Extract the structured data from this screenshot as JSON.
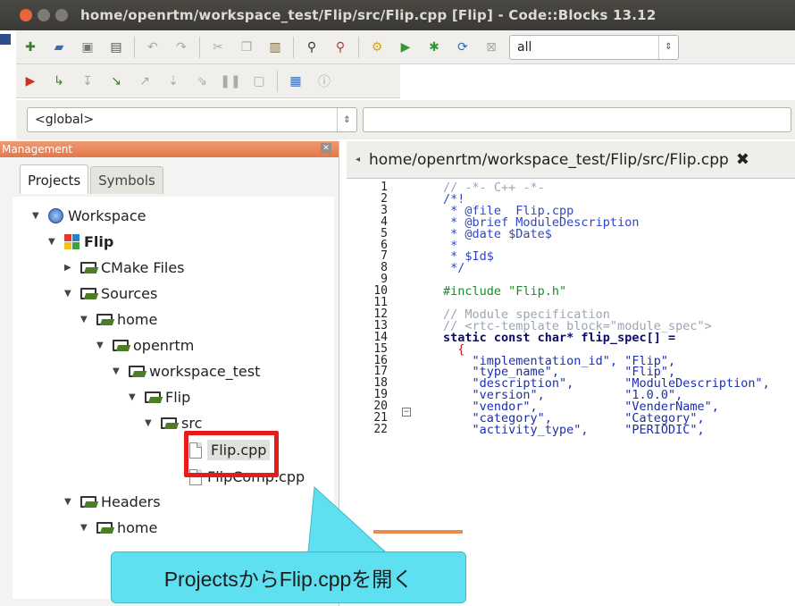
{
  "window": {
    "title": "home/openrtm/workspace_test/Flip/src/Flip.cpp [Flip] - Code::Blocks 13.12"
  },
  "toolbar": {
    "build_target": "all"
  },
  "scope": {
    "selected": "<global>"
  },
  "management": {
    "title": "Management",
    "tabs": [
      {
        "label": "Projects",
        "active": true
      },
      {
        "label": "Symbols",
        "active": false
      }
    ],
    "tree": {
      "workspace": "Workspace",
      "project": "Flip",
      "cmake_files": "CMake Files",
      "sources": "Sources",
      "home": "home",
      "openrtm": "openrtm",
      "workspace_test": "workspace_test",
      "flip_dir": "Flip",
      "src": "src",
      "flip_cpp": "Flip.cpp",
      "flipcomp_cpp": "FlipComp.cpp",
      "headers": "Headers",
      "headers_home": "home"
    }
  },
  "editor": {
    "tab_label": "home/openrtm/workspace_test/Flip/src/Flip.cpp",
    "line_numbers": [
      "1",
      "2",
      "3",
      "4",
      "5",
      "6",
      "7",
      "8",
      "9",
      "10",
      "11",
      "12",
      "13",
      "14",
      "15",
      "16",
      "17",
      "18",
      "19",
      "20",
      "21",
      "22"
    ],
    "lines": [
      "// -*- C++ -*-",
      "/*!",
      " * @file  Flip.cpp",
      " * @brief ModuleDescription",
      " * @date $Date$",
      " *",
      " * $Id$",
      " */",
      "",
      "#include \"Flip.h\"",
      "",
      "// Module specification",
      "// <rtc-template block=\"module_spec\">",
      "static const char* flip_spec[] =",
      "  {",
      "    \"implementation_id\", \"Flip\",",
      "    \"type_name\",         \"Flip\",",
      "    \"description\",       \"ModuleDescription\",",
      "    \"version\",           \"1.0.0\",",
      "    \"vendor\",            \"VenderName\",",
      "    \"category\",          \"Category\",",
      "    \"activity_type\",     \"PERIODIC\","
    ]
  },
  "callout": {
    "text": "ProjectsからFlip.cppを開く"
  },
  "colors": {
    "highlight_border": "#e81b1b",
    "callout_fill": "#5ee0f1",
    "management_header": "#e2774a"
  }
}
